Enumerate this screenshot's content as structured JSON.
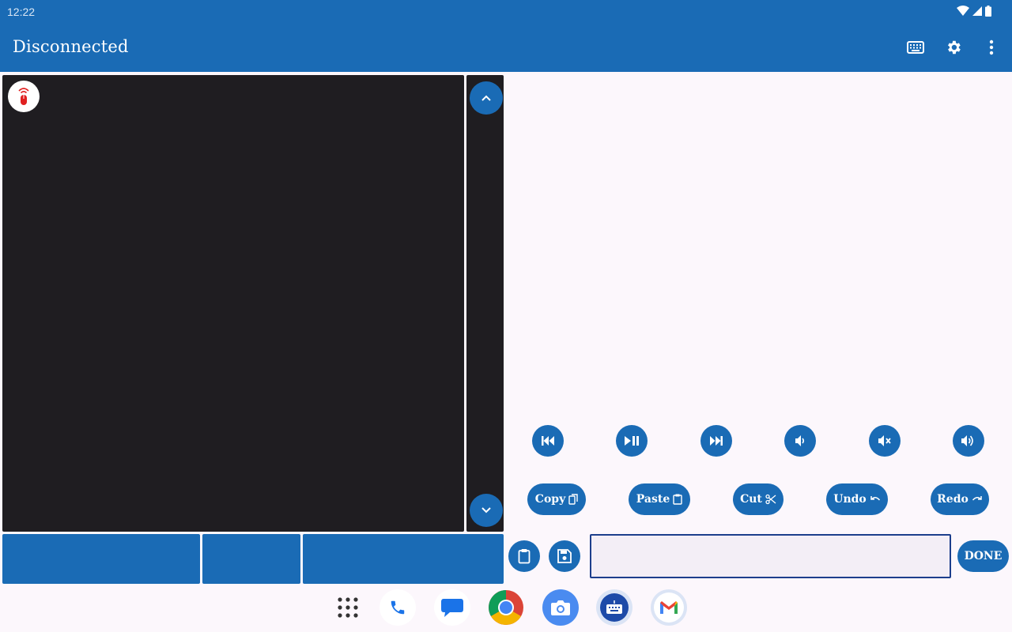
{
  "status_bar": {
    "time": "12:22"
  },
  "app_bar": {
    "title": "Disconnected",
    "icons": [
      "keyboard-icon",
      "settings-icon",
      "more-vert-icon"
    ]
  },
  "touchpad": {
    "badge_icon": "remote-mouse-icon"
  },
  "scroll": {
    "up_icon": "chevron-up-icon",
    "down_icon": "chevron-down-icon"
  },
  "media_controls": [
    {
      "name": "previous-track",
      "icon": "skip-previous-icon"
    },
    {
      "name": "play-pause",
      "icon": "play-pause-icon"
    },
    {
      "name": "next-track",
      "icon": "skip-next-icon"
    },
    {
      "name": "volume-down",
      "icon": "volume-down-icon"
    },
    {
      "name": "mute",
      "icon": "volume-mute-icon"
    },
    {
      "name": "volume-up",
      "icon": "volume-up-icon"
    }
  ],
  "edit_actions": {
    "copy": "Copy",
    "paste": "Paste",
    "cut": "Cut",
    "undo": "Undo",
    "redo": "Redo"
  },
  "input_bar": {
    "clipboard_icon": "clipboard-icon",
    "save_icon": "save-icon",
    "text_value": "",
    "done_label": "DONE"
  },
  "dock": {
    "apps": [
      "app-drawer",
      "phone",
      "messages",
      "chrome",
      "camera",
      "remote-keyboard",
      "gmail"
    ]
  },
  "colors": {
    "primary": "#1a6bb5",
    "touchpad": "#1f1d21",
    "background": "#fcf7fc",
    "input_border": "#1c3e8c"
  }
}
